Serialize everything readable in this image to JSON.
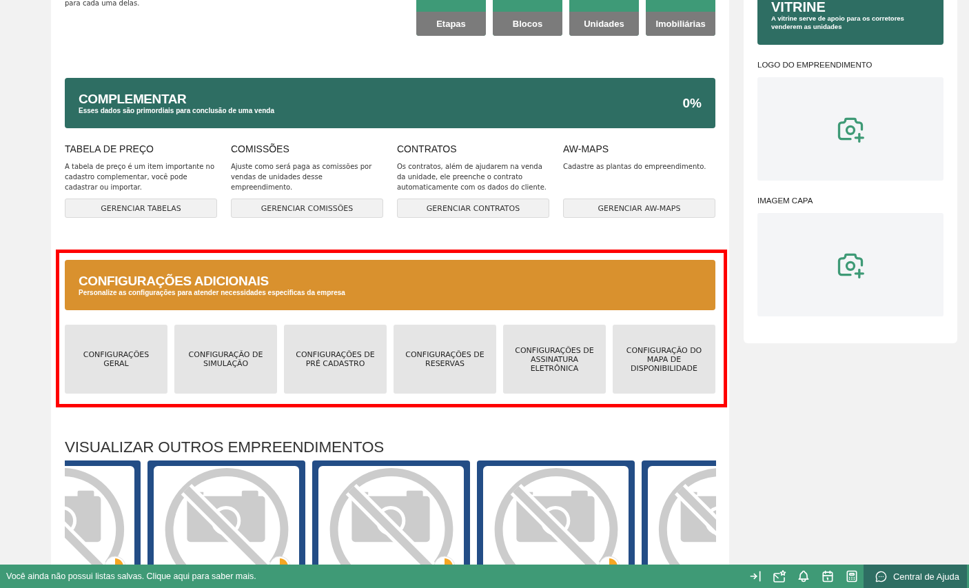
{
  "intro": {
    "text": "para cada uma delas."
  },
  "stats": [
    {
      "label": "Etapas"
    },
    {
      "label": "Blocos"
    },
    {
      "label": "Unidades"
    },
    {
      "label": "Imobiliárias"
    }
  ],
  "complementar": {
    "title": "COMPLEMENTAR",
    "subtitle": "Esses dados são primordiais para conclusão de uma venda",
    "progress": "0%",
    "sections": [
      {
        "title": "TABELA DE PREÇO",
        "description": "A tabela de preço é um item importante no cadastro complementar, você pode cadastrar ou importar.",
        "button": "GERENCIAR TABELAS"
      },
      {
        "title": "COMISSÕES",
        "description": "Ajuste como será paga as comissões por vendas de unidades desse empreendimento.",
        "button": "GERENCIAR COMISSÕES"
      },
      {
        "title": "CONTRATOS",
        "description": "Os contratos, além de ajudarem na venda da unidade, ele preenche o contrato automaticamente com os dados do cliente.",
        "button": "GERENCIAR CONTRATOS"
      },
      {
        "title": "AW-MAPS",
        "description": "Cadastre as plantas do empreendimento.",
        "button": "GERENCIAR AW-MAPS"
      }
    ]
  },
  "additional_settings": {
    "highlighted": true,
    "title": "CONFIGURAÇÕES ADICIONAIS",
    "subtitle": "Personalize as configurações para atender necessidades especificas da empresa",
    "tiles": [
      {
        "label": "CONFIGURAÇÕES GERAL"
      },
      {
        "label": "CONFIGURAÇÃO DE SIMULAÇÃO"
      },
      {
        "label": "CONFIGURAÇÕES DE PRÉ CADASTRO"
      },
      {
        "label": "CONFIGURAÇÕES DE RESERVAS"
      },
      {
        "label": "CONFIGURAÇÕES DE ASSINATURA ELETRÔNICA"
      },
      {
        "label": "CONFIGURAÇÃO DO MAPA DE DISPONIBILIDADE"
      }
    ]
  },
  "other_projects": {
    "title": "VISUALIZAR OUTROS EMPREENDIMENTOS",
    "cards": [
      {
        "kind": "cut_left"
      },
      {
        "kind": "full"
      },
      {
        "kind": "full"
      },
      {
        "kind": "full"
      },
      {
        "kind": "cut_right"
      }
    ]
  },
  "vitrine": {
    "title": "VITRINE",
    "subtitle": "A vitrine serve de apoio para os corretores venderem as unidades",
    "uploads": [
      {
        "label": "LOGO DO EMPREENDIMENTO"
      },
      {
        "label": "IMAGEM CAPA"
      }
    ]
  },
  "status_bar": {
    "message": "Você ainda não possui listas salvas. Clique aqui para saber mais.",
    "help": "Central de Ajuda"
  }
}
